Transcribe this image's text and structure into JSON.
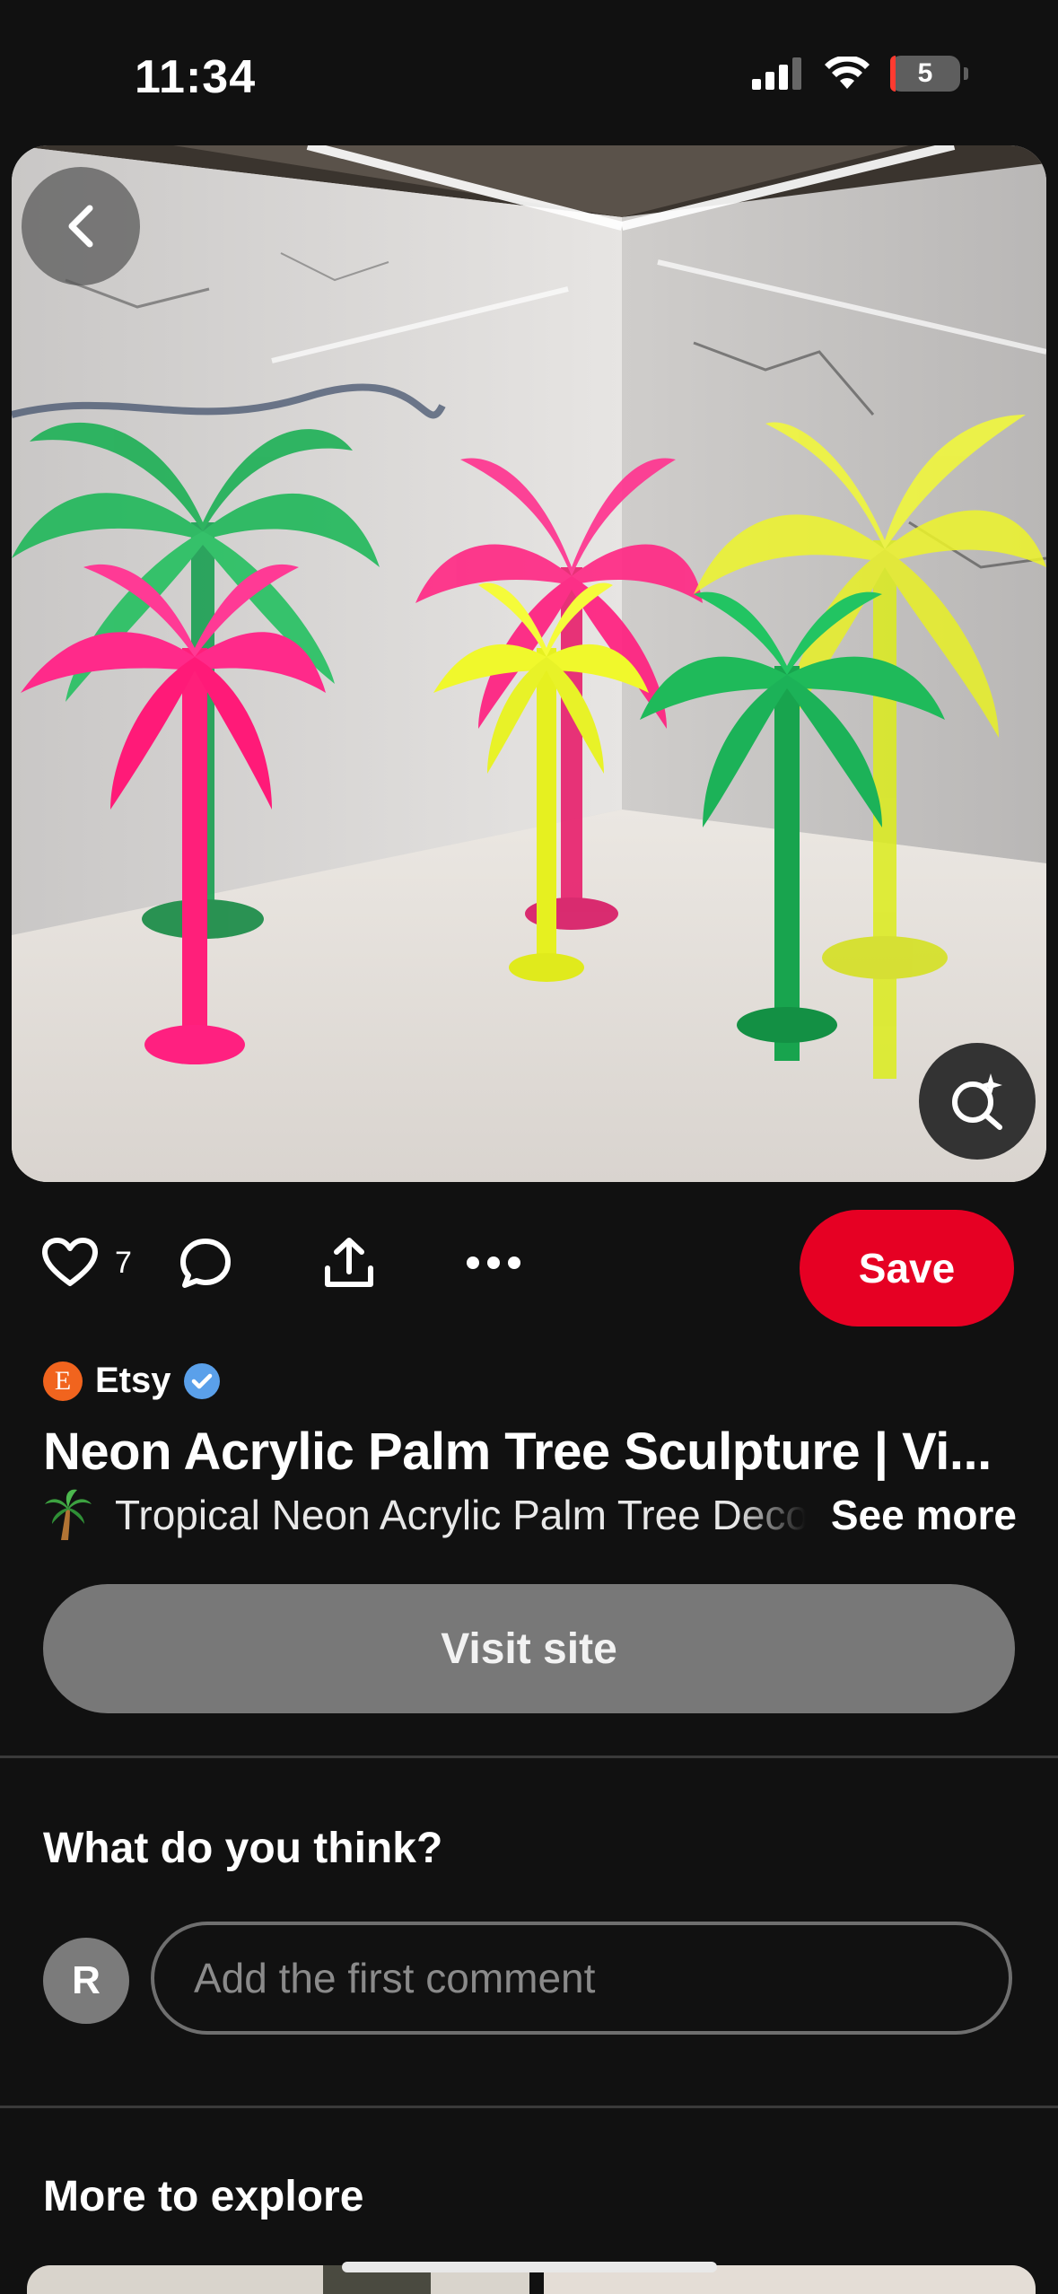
{
  "status_bar": {
    "time": "11:34",
    "battery": "5"
  },
  "pin": {
    "like_count": "7",
    "save_label": "Save",
    "source_name": "Etsy",
    "source_logo_letter": "E",
    "title": "Neon Acrylic Palm Tree Sculpture | Vi...",
    "description": "Tropical Neon Acrylic Palm Tree Decor",
    "see_more_label": "See more",
    "visit_label": "Visit site"
  },
  "comments": {
    "heading": "What do you think?",
    "avatar_initial": "R",
    "placeholder": "Add the first comment"
  },
  "explore": {
    "heading": "More to explore"
  },
  "colors": {
    "save": "#e60023",
    "etsy": "#f1641e",
    "verified": "#5aa0ea",
    "background": "#111111"
  }
}
